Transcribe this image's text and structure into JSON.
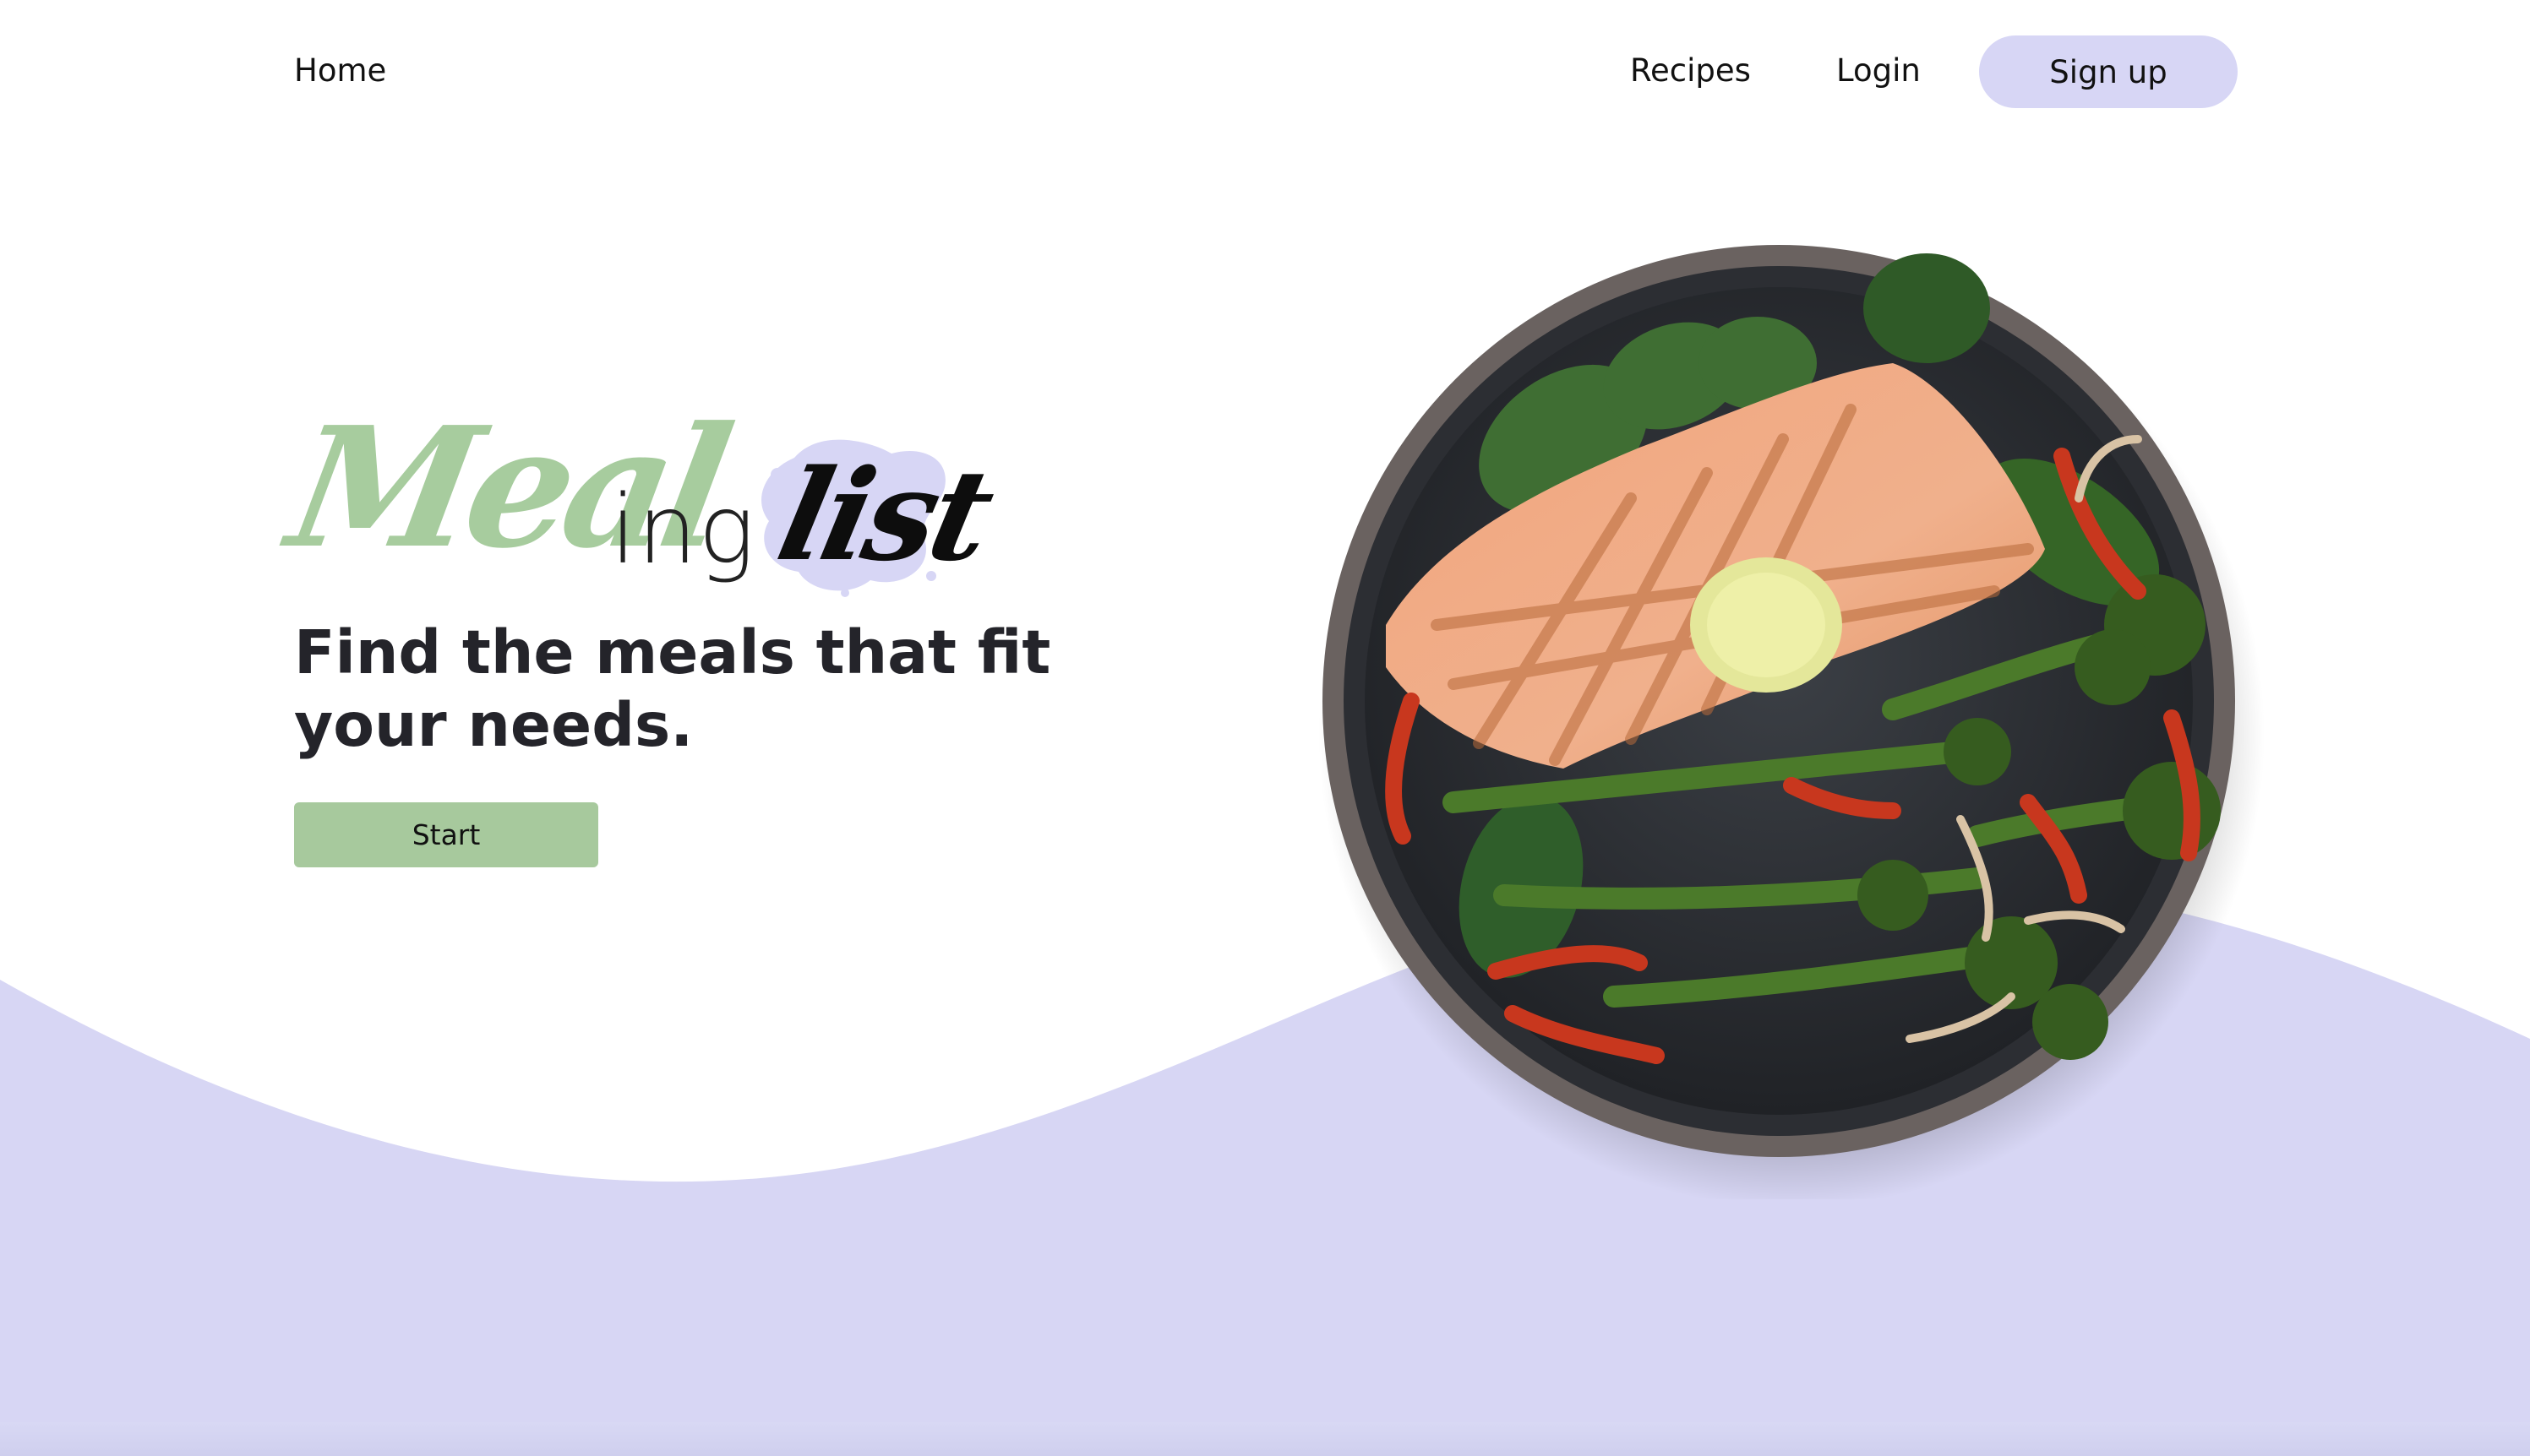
{
  "nav": {
    "home": "Home",
    "recipes": "Recipes",
    "login": "Login",
    "signup": "Sign up"
  },
  "hero": {
    "logo_part1": "Meal",
    "logo_part2": "ing",
    "logo_part3": "list",
    "tagline": "Find the meals that fit your needs.",
    "start": "Start"
  },
  "colors": {
    "accent_lavender": "#d7d6f5",
    "accent_green": "#a7cc9e",
    "wave": "#d7d6f4"
  }
}
